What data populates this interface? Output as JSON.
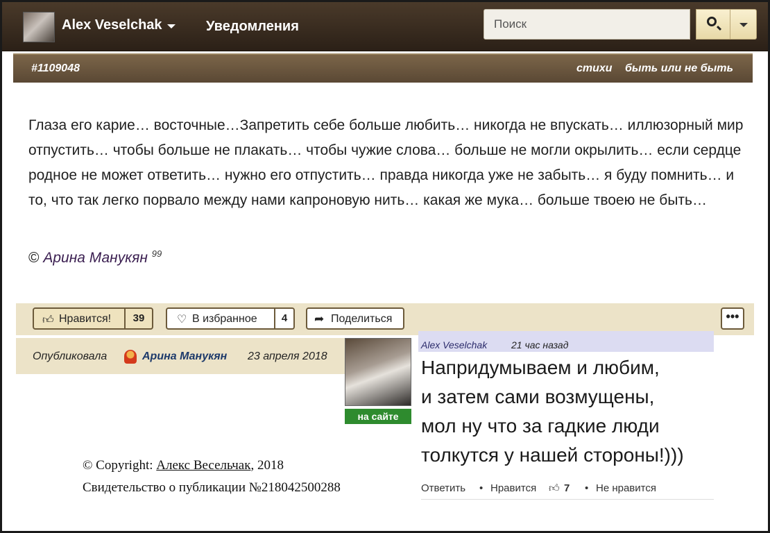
{
  "navbar": {
    "user_name": "Alex Veselchak",
    "notifications_label": "Уведомления",
    "search_placeholder": "Поиск"
  },
  "post": {
    "id": "#1109048",
    "tags": [
      "стихи",
      "быть или не быть"
    ],
    "text": "Глаза его карие… восточные…Запретить себе больше любить… никогда не впускать… иллюзорный мир отпустить… чтобы больше не плакать… чтобы чужие слова… больше не могли окрылить… если сердце родное не может ответить… нужно его отпустить… правда никогда уже не забыть… я буду помнить… и то, что так легко порвало между нами капроновую нить… какая же мука… больше твоею не быть…",
    "signature_prefix": "©",
    "signature_author": "Арина Манукян",
    "signature_sup": "99"
  },
  "actions": {
    "like_label": "Нравится!",
    "like_count": "39",
    "favorite_label": "В избранное",
    "favorite_count": "4",
    "share_label": "Поделиться",
    "more_label": "•••"
  },
  "published": {
    "label": "Опубликовала",
    "author": "Арина Манукян",
    "date": "23 апреля 2018"
  },
  "comment": {
    "user": "Alex Veselchak",
    "time": "21 час назад",
    "status": "на сайте",
    "lines": [
      "Напридумываем и любим,",
      "и затем сами возмущены,",
      "мол ну что за гадкие люди",
      "толкутся у нашей стороны!)))"
    ],
    "reply_label": "Ответить",
    "like_label": "Нравится",
    "like_count": "7",
    "dislike_label": "Не нравится",
    "separator": "•"
  },
  "copyright": {
    "prefix": "© Copyright: ",
    "author": "Алекс Весельчак",
    "year": ", 2018",
    "certificate": "Свидетельство о публикации №218042500288"
  }
}
